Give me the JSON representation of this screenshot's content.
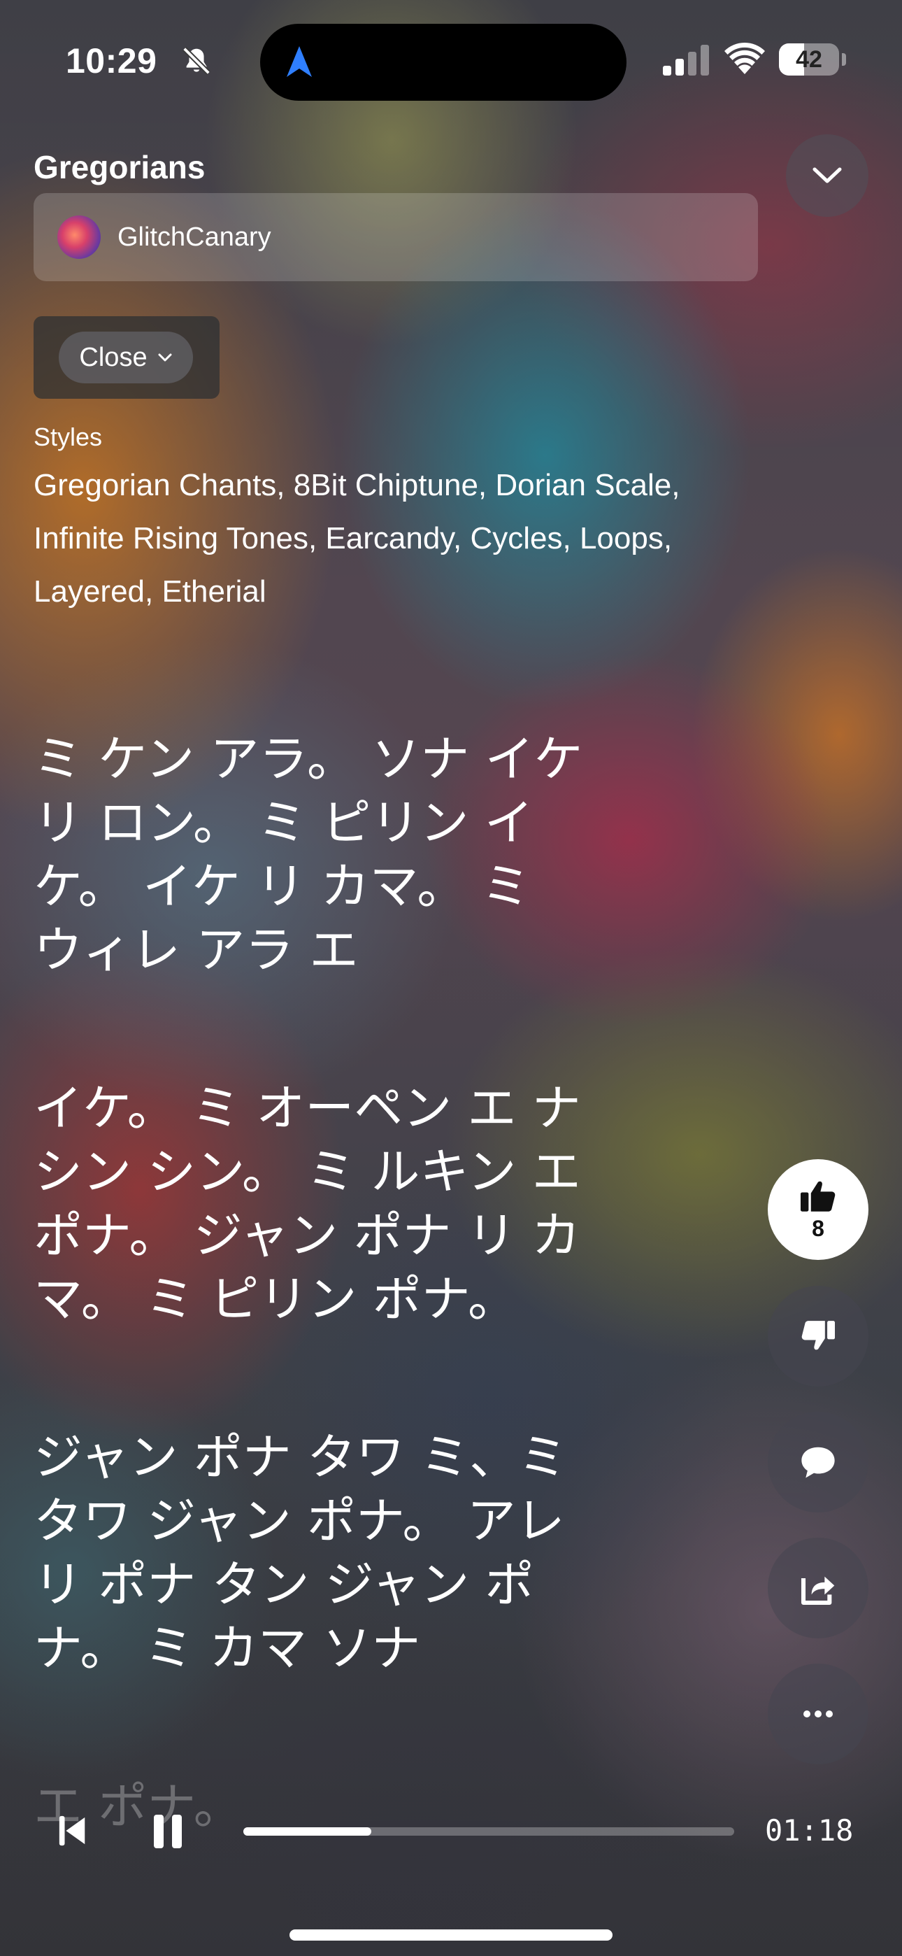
{
  "status_bar": {
    "time": "10:29",
    "battery": "42",
    "battery_level": 0.42
  },
  "header": {
    "song_title": "Gregorians",
    "artist": "GlitchCanary",
    "close_label": "Close"
  },
  "styles": {
    "label": "Styles",
    "text": "Gregorian Chants, 8Bit Chiptune, Dorian Scale, Infinite Rising Tones, Earcandy, Cycles, Loops, Layered, Etherial"
  },
  "lyrics": [
    "ミ ケン アラ。 ソナ イケ\nリ ロン。 ミ ピリン イ\nケ。 イケ リ カマ。 ミ\nウィレ アラ エ",
    "イケ。 ミ オーペン エ ナ\nシン シン。 ミ ルキン エ\nポナ。 ジャン ポナ リ カ\nマ。 ミ ピリン ポナ。",
    "ジャン ポナ タワ ミ、ミ\nタワ ジャン ポナ。 アレ\nリ ポナ タン ジャン ポ\nナ。 ミ カマ ソナ",
    "エ ポナ。"
  ],
  "actions": {
    "like_count": "8"
  },
  "player": {
    "elapsed": "01:18",
    "progress": 0.26
  },
  "icons": {
    "bell": "bell-slash-icon",
    "location": "location-arrow-icon",
    "collapse": "chevron-down-icon",
    "like": "thumbs-up-icon",
    "dislike": "thumbs-down-icon",
    "comment": "comment-icon",
    "share": "share-icon",
    "more": "more-icon",
    "prev": "skip-back-icon",
    "pause": "pause-icon"
  },
  "colors": {
    "location_arrow": "#2f7fff",
    "like_bg": "#ffffff"
  }
}
